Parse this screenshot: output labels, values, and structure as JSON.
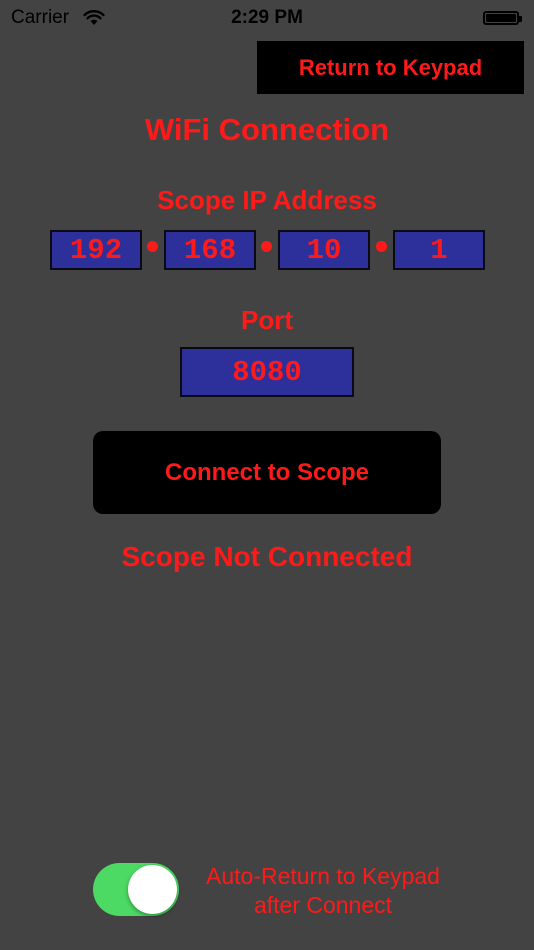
{
  "status_bar": {
    "carrier": "Carrier",
    "wifi_icon": "wifi-icon",
    "time": "2:29 PM",
    "battery_icon": "battery-full-icon"
  },
  "header": {
    "return_button_label": "Return to Keypad"
  },
  "main": {
    "title": "WiFi Connection",
    "ip_label": "Scope IP Address",
    "ip_octets": [
      "192",
      "168",
      "10",
      "1"
    ],
    "port_label": "Port",
    "port_value": "8080",
    "connect_button_label": "Connect to Scope",
    "connection_status": "Scope Not Connected"
  },
  "footer": {
    "auto_return_toggle_on": true,
    "auto_return_label_line1": "Auto-Return to Keypad",
    "auto_return_label_line2": "after Connect"
  },
  "colors": {
    "background": "#434343",
    "text_accent": "#ff1a1a",
    "field_background": "#2d2f9a",
    "button_background": "#000000",
    "toggle_on": "#4cd964"
  }
}
